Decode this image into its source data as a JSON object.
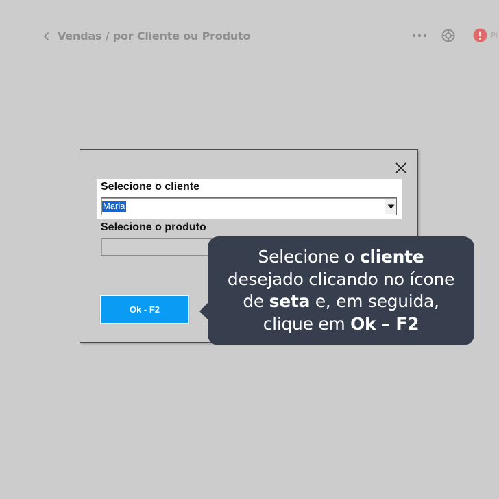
{
  "header": {
    "breadcrumb": "Vendas / por Cliente ou Produto",
    "alert_label": "Pl",
    "icons": [
      "back-chevron-icon",
      "more-options-icon",
      "help-lifebuoy-icon",
      "alert-icon"
    ]
  },
  "dialog": {
    "client_label": "Selecione o cliente",
    "client_value": "Maria",
    "product_label": "Selecione o produto",
    "product_value": "",
    "ok_label": "Ok - F2"
  },
  "tooltip": {
    "line1_pre": "Selecione o ",
    "line1_bold": "cliente",
    "line2": "desejado clicando no ícone",
    "line3_pre": "de ",
    "line3_bold": "seta",
    "line3_post": " e, em seguida,",
    "line4_pre": "clique em ",
    "line4_bold": "Ok – F2"
  },
  "colors": {
    "background": "#cccccc",
    "ok_button": "#0a9bf5",
    "tooltip_bg": "#373f4e",
    "selection": "#1b66cc",
    "alert": "#e06a6a"
  }
}
